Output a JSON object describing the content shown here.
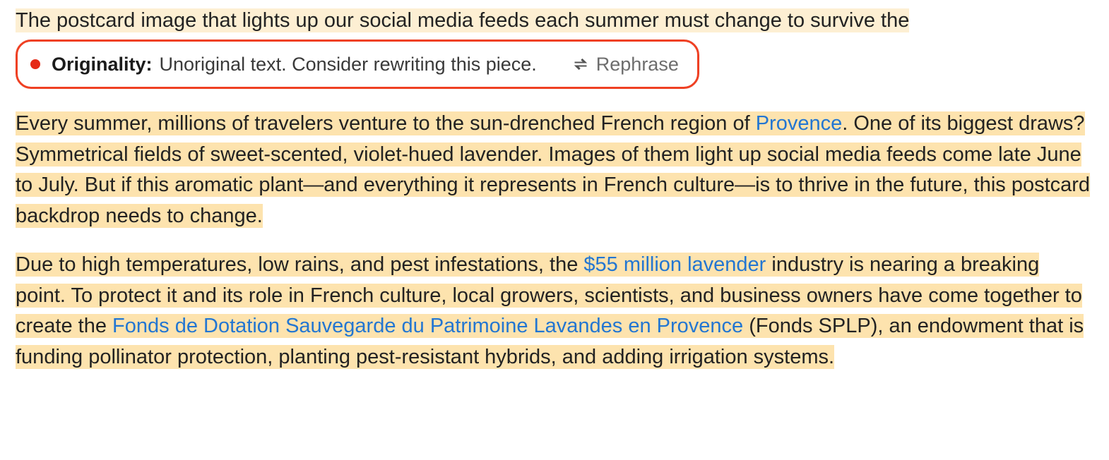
{
  "intro_sentence": "The postcard image that lights up our social media feeds each summer must change to survive the",
  "callout": {
    "label": "Originality:",
    "message": "Unoriginal text. Consider rewriting this piece.",
    "action_label": "Rephrase",
    "status_color": "#e52a17",
    "border_color": "#ef4023"
  },
  "paragraphs": {
    "p1": {
      "seg1": "Every summer, millions of travelers venture to the sun-drenched French region of ",
      "link1": "Provence",
      "seg2": ". One of its biggest draws? Symmetrical fields of sweet-scented, violet-hued lavender. Images of them light up social media feeds come late June to July. But if this aromatic plant—and everything it represents in French culture—is to thrive in the future, this postcard backdrop needs to change."
    },
    "p2": {
      "seg1": "Due to high temperatures, low rains, and pest infestations, the ",
      "link1": "$55 million lavender",
      "seg2": " industry is nearing a breaking point. To protect it and its role in French culture, local growers, scientists, and business owners have come together to create the ",
      "link2": "Fonds de Dotation Sauvegarde du Patrimoine Lavandes en Provence",
      "seg3": " (Fonds SPLP), an endowment that is funding pollinator protection, planting pest-resistant hybrids, and adding irrigation systems."
    }
  }
}
